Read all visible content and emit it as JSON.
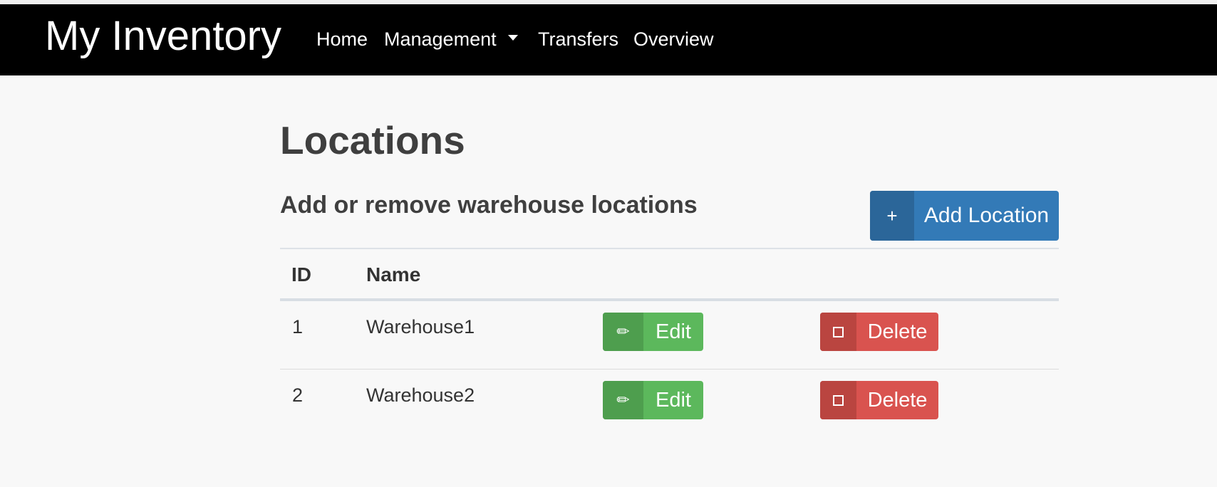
{
  "nav": {
    "brand": "My Inventory",
    "items": [
      {
        "label": "Home"
      },
      {
        "label": "Management"
      },
      {
        "label": "Transfers"
      },
      {
        "label": "Overview"
      }
    ],
    "dropdown_icon": "caret-down-icon"
  },
  "page": {
    "title": "Locations",
    "subtitle": "Add or remove warehouse locations"
  },
  "actions": {
    "add": {
      "icon": "plus-icon",
      "glyph": "+",
      "label": "Add Location"
    }
  },
  "table": {
    "columns": [
      "ID",
      "Name"
    ],
    "rows": [
      {
        "id": "1",
        "name": "Warehouse1",
        "edit_label": "Edit",
        "delete_label": "Delete"
      },
      {
        "id": "2",
        "name": "Warehouse2",
        "edit_label": "Edit",
        "delete_label": "Delete"
      }
    ],
    "edit_icon": "pencil-icon",
    "edit_glyph": "✏",
    "delete_icon": "trash-icon"
  },
  "colors": {
    "navbar": "#000000",
    "primary": "#337ab7",
    "success": "#5cb85c",
    "danger": "#d9534f",
    "background": "#f8f8f8"
  }
}
